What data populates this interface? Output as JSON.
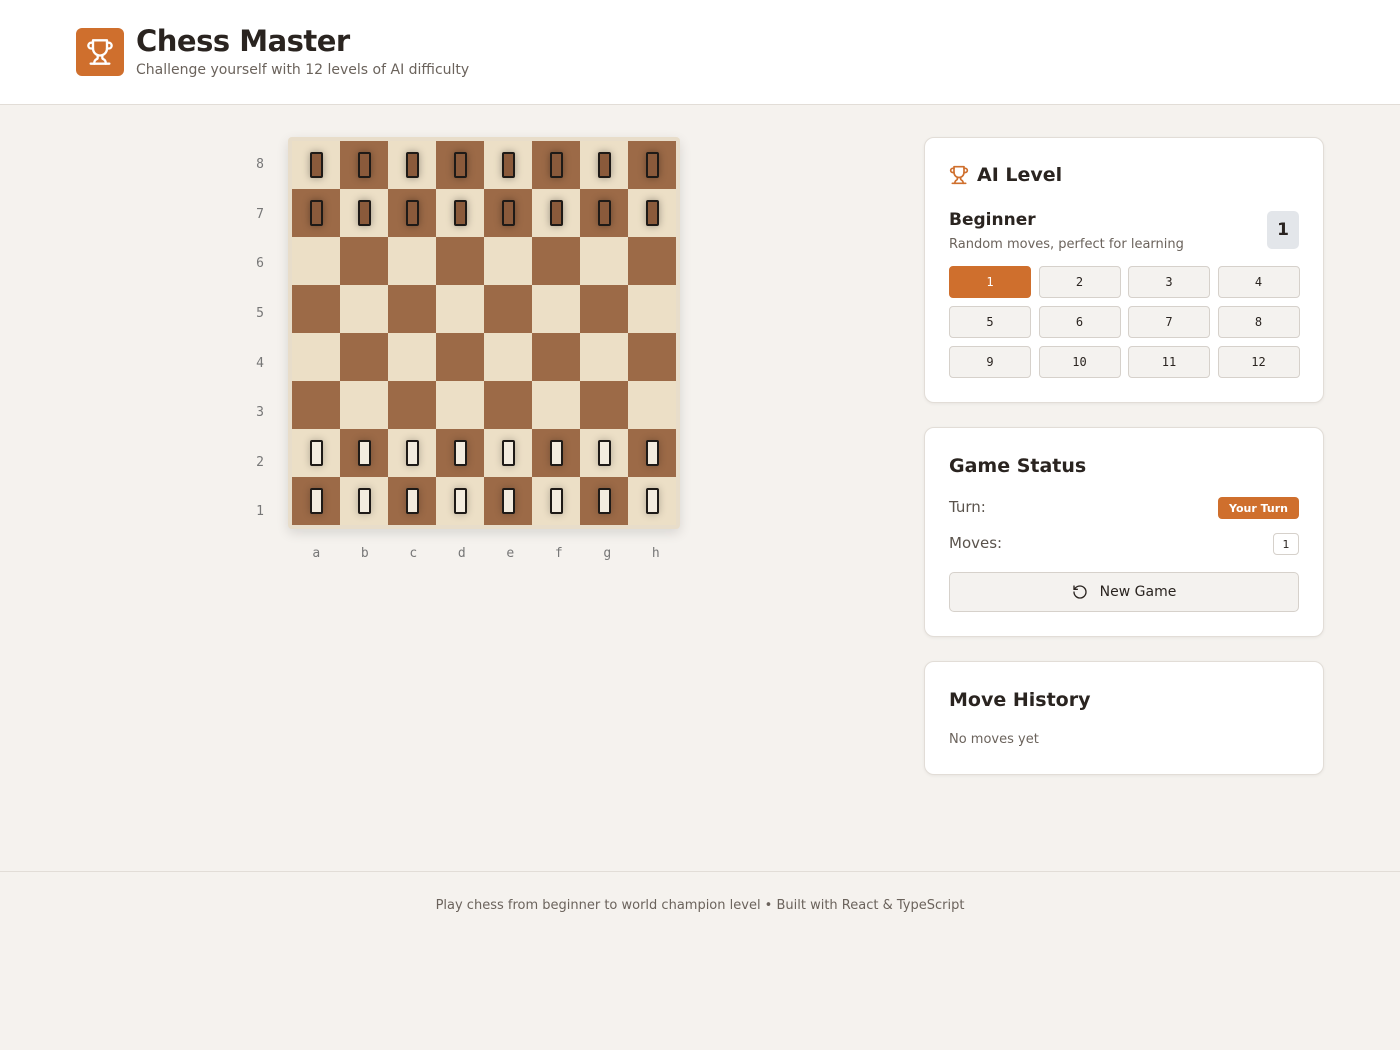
{
  "header": {
    "title": "Chess Master",
    "subtitle": "Challenge yourself with 12 levels of AI difficulty",
    "logo_icon": "trophy-icon"
  },
  "board": {
    "ranks": [
      "8",
      "7",
      "6",
      "5",
      "4",
      "3",
      "2",
      "1"
    ],
    "files": [
      "a",
      "b",
      "c",
      "d",
      "e",
      "f",
      "g",
      "h"
    ],
    "light_color": "#ecdfc6",
    "dark_color": "#9c6a47",
    "occupied": {
      "8": "black",
      "7": "black",
      "2": "white",
      "1": "white"
    }
  },
  "ai_level": {
    "title": "AI Level",
    "icon": "trophy-icon",
    "current_name": "Beginner",
    "current_desc": "Random moves, perfect for learning",
    "current_level": "1",
    "levels": [
      "1",
      "2",
      "3",
      "4",
      "5",
      "6",
      "7",
      "8",
      "9",
      "10",
      "11",
      "12"
    ],
    "selected": "1"
  },
  "game_status": {
    "title": "Game Status",
    "turn_label": "Turn:",
    "turn_value": "Your Turn",
    "moves_label": "Moves:",
    "moves_value": "1",
    "new_game_label": "New Game",
    "new_game_icon": "restart-icon"
  },
  "move_history": {
    "title": "Move History",
    "empty_text": "No moves yet"
  },
  "footer": {
    "text": "Play chess from beginner to world champion level • Built with React & TypeScript"
  },
  "colors": {
    "accent": "#cf6f2d",
    "background": "#f5f2ee"
  }
}
